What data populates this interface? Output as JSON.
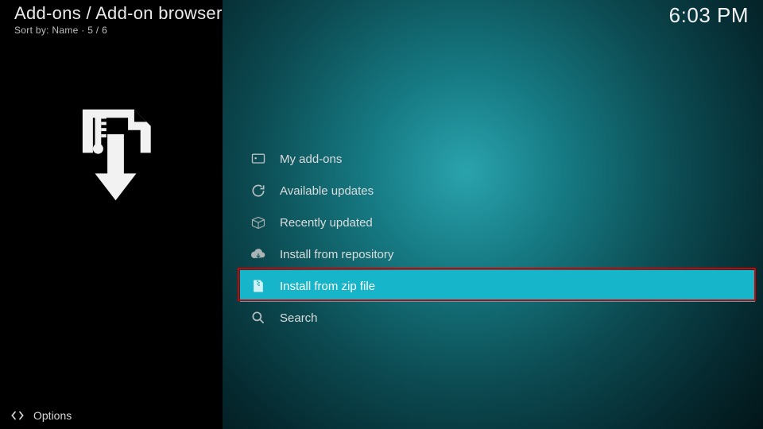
{
  "header": {
    "breadcrumb": "Add-ons / Add-on browser",
    "sort_prefix": "Sort by:",
    "sort_value": "Name",
    "position": "5 / 6",
    "clock": "6:03 PM"
  },
  "menu": {
    "items": [
      {
        "label": "My add-ons",
        "icon": "addon-icon",
        "selected": false
      },
      {
        "label": "Available updates",
        "icon": "refresh-icon",
        "selected": false
      },
      {
        "label": "Recently updated",
        "icon": "box-icon",
        "selected": false
      },
      {
        "label": "Install from repository",
        "icon": "cloud-download-icon",
        "selected": false
      },
      {
        "label": "Install from zip file",
        "icon": "zip-icon",
        "selected": true
      },
      {
        "label": "Search",
        "icon": "search-icon",
        "selected": false
      }
    ]
  },
  "footer": {
    "options_label": "Options"
  },
  "colors": {
    "accent": "#17b5c9",
    "highlight_ring": "#d40000"
  }
}
